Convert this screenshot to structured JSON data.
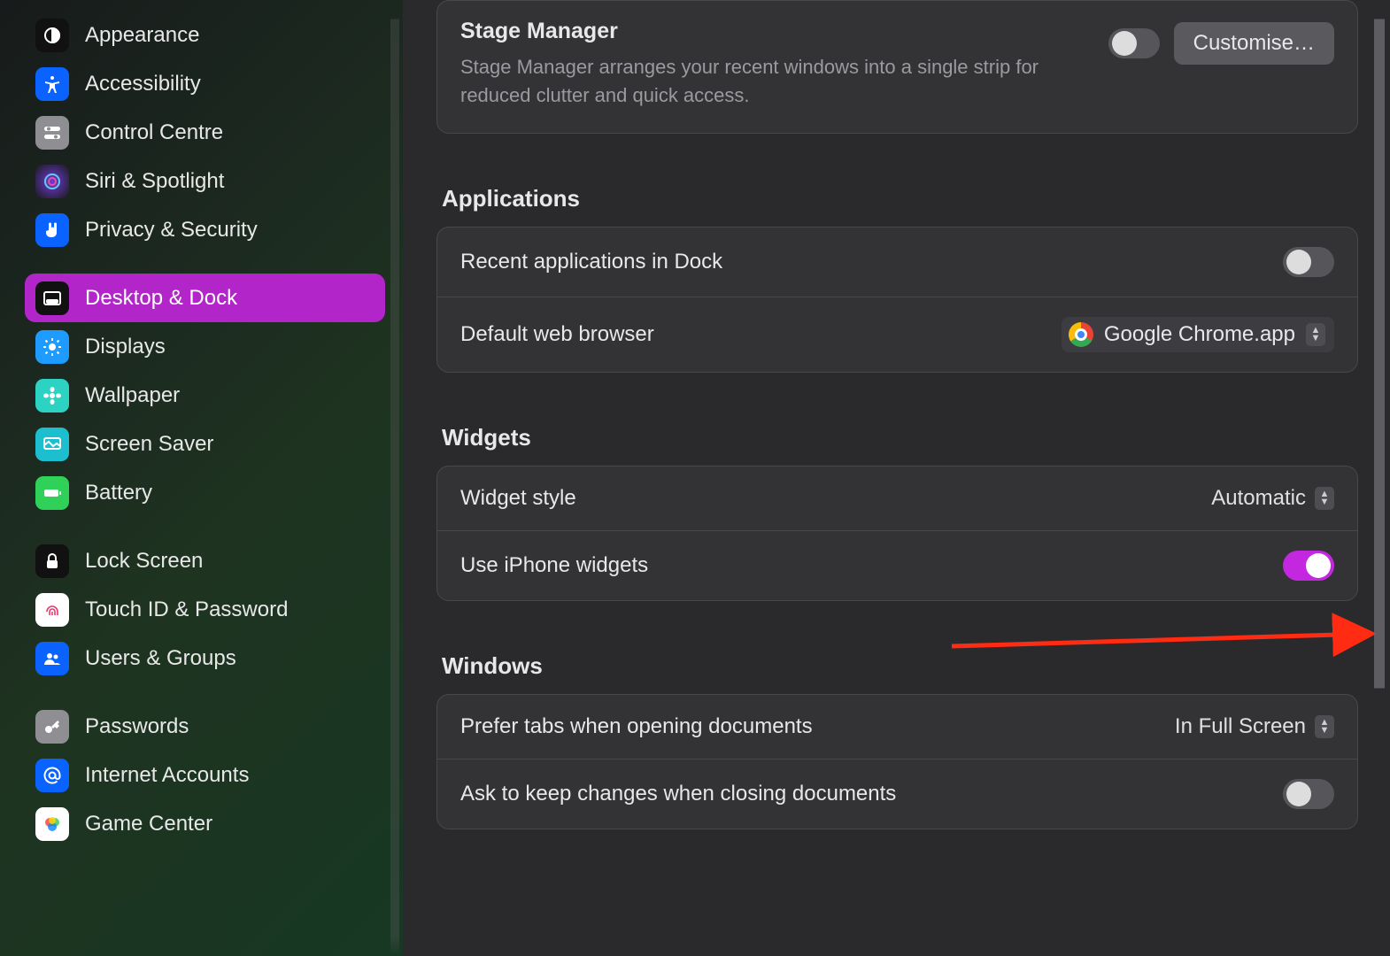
{
  "sidebar": {
    "items": [
      {
        "id": "appearance",
        "label": "Appearance",
        "icon": "appearance",
        "color": "#111",
        "selected": false
      },
      {
        "id": "accessibility",
        "label": "Accessibility",
        "icon": "accessibility",
        "color": "#0a62ff",
        "selected": false
      },
      {
        "id": "control-centre",
        "label": "Control Centre",
        "icon": "switches",
        "color": "#8e8e93",
        "selected": false
      },
      {
        "id": "siri-spotlight",
        "label": "Siri & Spotlight",
        "icon": "siri",
        "color": "#111",
        "selected": false
      },
      {
        "id": "privacy-security",
        "label": "Privacy & Security",
        "icon": "hand",
        "color": "#0a62ff",
        "selected": false
      },
      {
        "id": "desktop-dock",
        "label": "Desktop & Dock",
        "icon": "dock",
        "color": "#111",
        "selected": true
      },
      {
        "id": "displays",
        "label": "Displays",
        "icon": "sun",
        "color": "#1e9bff",
        "selected": false
      },
      {
        "id": "wallpaper",
        "label": "Wallpaper",
        "icon": "flower",
        "color": "#2cd3c3",
        "selected": false
      },
      {
        "id": "screen-saver",
        "label": "Screen Saver",
        "icon": "screensaver",
        "color": "#1dbfcf",
        "selected": false
      },
      {
        "id": "battery",
        "label": "Battery",
        "icon": "battery",
        "color": "#30d158",
        "selected": false
      },
      {
        "id": "lock-screen",
        "label": "Lock Screen",
        "icon": "lock",
        "color": "#111",
        "selected": false
      },
      {
        "id": "touch-id",
        "label": "Touch ID & Password",
        "icon": "fingerprint",
        "color": "#fff",
        "selected": false
      },
      {
        "id": "users-groups",
        "label": "Users & Groups",
        "icon": "users",
        "color": "#0a62ff",
        "selected": false
      },
      {
        "id": "passwords",
        "label": "Passwords",
        "icon": "key",
        "color": "#8e8e93",
        "selected": false
      },
      {
        "id": "internet-acc",
        "label": "Internet Accounts",
        "icon": "at",
        "color": "#0a62ff",
        "selected": false
      },
      {
        "id": "game-center",
        "label": "Game Center",
        "icon": "gamecenter",
        "color": "#fff",
        "selected": false
      }
    ],
    "gap_after": [
      "privacy-security",
      "battery",
      "users-groups"
    ]
  },
  "main": {
    "stage_manager": {
      "title": "Stage Manager",
      "description": "Stage Manager arranges your recent windows into a single strip for reduced clutter and quick access.",
      "toggle_on": false,
      "customise_label": "Customise…"
    },
    "sections": {
      "applications": {
        "heading": "Applications",
        "recent_apps_label": "Recent applications in Dock",
        "recent_apps_on": false,
        "default_browser_label": "Default web browser",
        "default_browser_value": "Google Chrome.app"
      },
      "widgets": {
        "heading": "Widgets",
        "style_label": "Widget style",
        "style_value": "Automatic",
        "use_iphone_label": "Use iPhone widgets",
        "use_iphone_on": true
      },
      "windows": {
        "heading": "Windows",
        "prefer_tabs_label": "Prefer tabs when opening documents",
        "prefer_tabs_value": "In Full Screen",
        "ask_keep_label": "Ask to keep changes when closing documents",
        "ask_keep_on": false
      }
    }
  },
  "annotation": {
    "type": "arrow",
    "color": "#ff2b12"
  }
}
